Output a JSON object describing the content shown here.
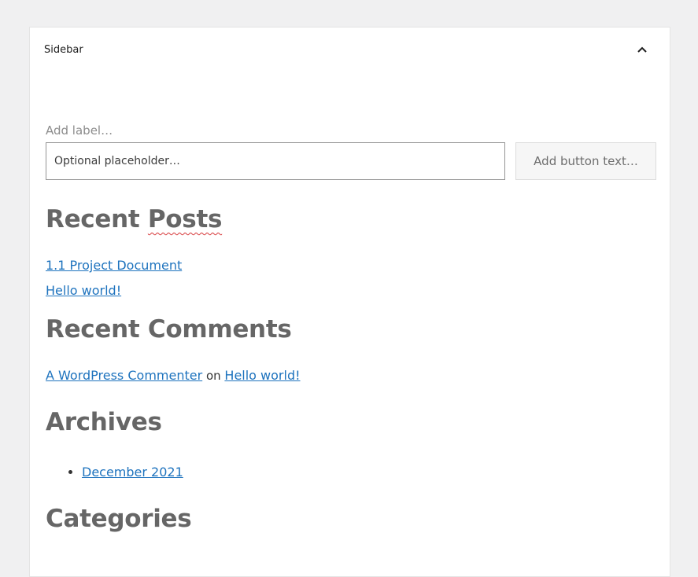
{
  "panel": {
    "title": "Sidebar",
    "toggle_icon": "chevron-up-icon"
  },
  "search": {
    "label": "Add label…",
    "placeholder": "Optional placeholder…",
    "button_label": "Add button text…"
  },
  "recent_posts": {
    "heading_part1": "Recent ",
    "heading_part2": "Posts",
    "items": [
      {
        "label": "1.1 Project Document"
      },
      {
        "label": "Hello world!"
      }
    ]
  },
  "recent_comments": {
    "heading": "Recent Comments",
    "items": [
      {
        "author": "A WordPress Commenter",
        "connector": " on ",
        "post": "Hello world!"
      }
    ]
  },
  "archives": {
    "heading": "Archives",
    "items": [
      {
        "label": "December 2021"
      }
    ]
  },
  "categories": {
    "heading": "Categories"
  },
  "colors": {
    "background": "#f0f0f1",
    "link": "#1e73be",
    "heading": "#666666"
  }
}
